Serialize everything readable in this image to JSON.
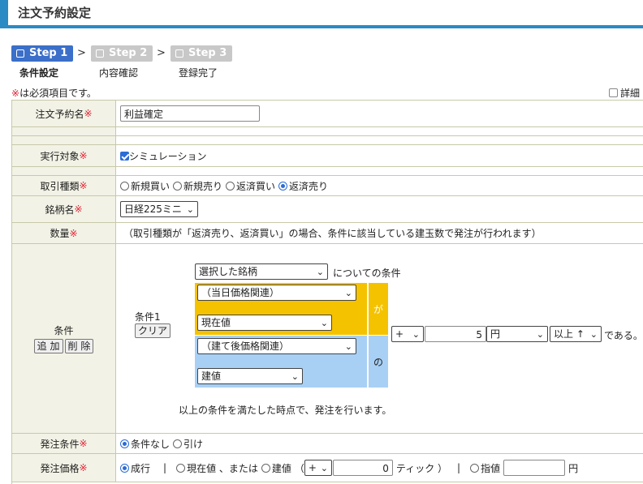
{
  "page": {
    "title": "注文予約設定"
  },
  "colors": {
    "accent": "#2a8ac4",
    "step_active": "#3b6fc9",
    "step_inactive": "#c8c8c8",
    "required": "#dd2233",
    "current_day_block": "#f5c200",
    "position_block": "#a8d0f5"
  },
  "steps": [
    {
      "label": "Step 1",
      "caption": "条件設定"
    },
    {
      "label": "Step 2",
      "caption": "内容確認"
    },
    {
      "label": "Step 3",
      "caption": "登録完了"
    }
  ],
  "step_separator": ">",
  "required_note": {
    "mark": "※",
    "text": "は必須項目です。"
  },
  "detail_checkbox": {
    "label": "詳細",
    "checked": false
  },
  "req_mark": "※",
  "form": {
    "name": {
      "label": "注文予約名",
      "value": "利益確定"
    },
    "target": {
      "label": "実行対象",
      "option": "シミュレーション",
      "checked": true
    },
    "trade_type": {
      "label": "取引種類",
      "options": [
        "新規買い",
        "新規売り",
        "返済買い",
        "返済売り"
      ],
      "selected": "返済売り"
    },
    "symbol": {
      "label": "銘柄名",
      "value": "日経225ミニ"
    },
    "quantity": {
      "label": "数量",
      "note": "（取引種類が「返済売り、返済買い」の場合、条件に該当している建玉数で発注が行われます）"
    },
    "condition": {
      "label": "条件",
      "add_button": "追 加",
      "delete_button": "削 除",
      "item_label": "条件1",
      "clear_button": "クリア",
      "target_select": "選択した銘柄",
      "target_suffix": "についての条件",
      "category1": "（当日価格関連）",
      "field1": "現在値",
      "connector1": "が",
      "category2": "（建て後価格関連）",
      "field2": "建値",
      "connector2": "の",
      "sign": "+",
      "amount": "5",
      "unit": "円",
      "comparison": "以上 ↑",
      "suffix": "である。",
      "footer": "以上の条件を満たした時点で、発注を行います。"
    },
    "order_condition": {
      "label": "発注条件",
      "options": [
        "条件なし",
        "引け"
      ],
      "selected": "条件なし"
    },
    "order_price": {
      "label": "発注価格",
      "market": "成行",
      "sep": "|",
      "current_or": "現在値 、または",
      "entry": "建値",
      "paren_open": "（",
      "sign": "+",
      "tick_value": "0",
      "tick_label": "ティック ）",
      "limit": "指値",
      "limit_value": "",
      "yen": "円",
      "selected": "成行"
    }
  }
}
